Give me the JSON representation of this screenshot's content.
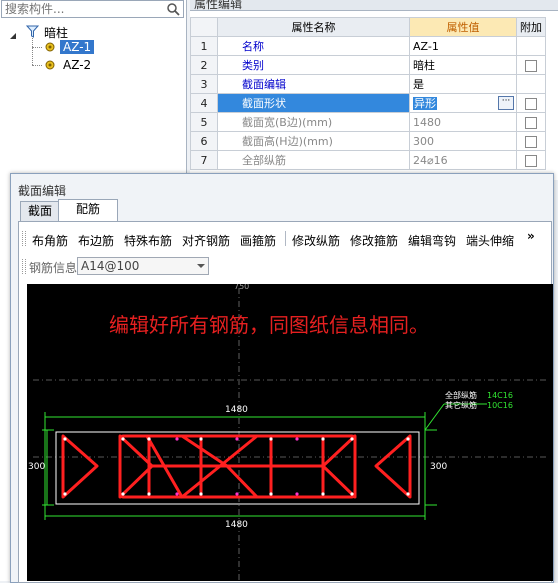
{
  "tree": {
    "search_placeholder": "搜索构件...",
    "root_label": "暗柱",
    "items": [
      {
        "label": "AZ-1",
        "selected": true
      },
      {
        "label": "AZ-2",
        "selected": false
      }
    ]
  },
  "grid": {
    "tab_label": "属性编辑",
    "headers": {
      "name": "属性名称",
      "value": "属性值",
      "extra": "附加"
    },
    "rows": [
      {
        "num": "1",
        "name": "名称",
        "value": "AZ-1"
      },
      {
        "num": "2",
        "name": "类别",
        "value": "暗柱"
      },
      {
        "num": "3",
        "name": "截面编辑",
        "value": "是"
      },
      {
        "num": "4",
        "name": "截面形状",
        "value": "异形"
      },
      {
        "num": "5",
        "name": "截面宽(B边)(mm)",
        "value": "1480"
      },
      {
        "num": "6",
        "name": "截面高(H边)(mm)",
        "value": "300"
      },
      {
        "num": "7",
        "name": "全部纵筋",
        "value": "24⌀16"
      }
    ]
  },
  "dialog": {
    "title": "截面编辑",
    "tabs": [
      "截面",
      "配筋"
    ],
    "active_tab": "配筋",
    "toolbar": [
      "布角筋",
      "布边筋",
      "特殊布筋",
      "对齐钢筋",
      "画箍筋",
      "修改纵筋",
      "修改箍筋",
      "编辑弯钩",
      "端头伸缩"
    ],
    "toolbar_more": "»",
    "rebar_label": "钢筋信息",
    "rebar_value": "A14@100"
  },
  "canvas": {
    "annotation": "编辑好所有钢筋，同图纸信息相同。",
    "dim_top": "1480",
    "dim_bottom": "1480",
    "dim_left": "300",
    "dim_right": "300",
    "center_mark": "750",
    "legend_all_label": "全部纵筋",
    "legend_all_value": "14C16",
    "legend_other_label": "其它纵筋",
    "legend_other_value": "10C16",
    "colors": {
      "rebar": "#ff2020",
      "dim": "#32e632",
      "annotation": "#e62020"
    }
  }
}
